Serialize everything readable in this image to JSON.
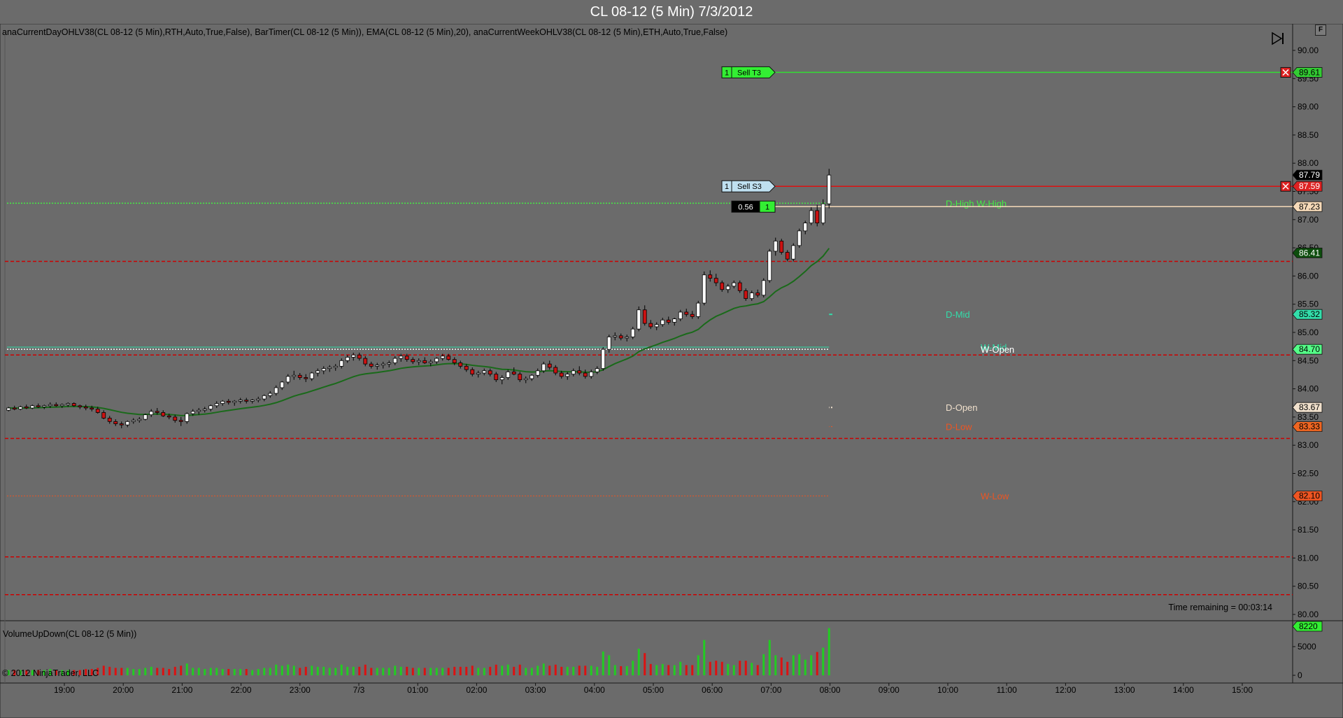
{
  "window": {
    "title": "CL 08-12 (5 Min)  7/3/2012"
  },
  "indicators_text": "anaCurrentDayOHLV38(CL  08-12  (5  Min),RTH,Auto,True,False),  BarTimer(CL  08-12  (5  Min)),  EMA(CL  08-12  (5  Min),20),  anaCurrentWeekOHLV38(CL  08-12  (5  Min),ETH,Auto,True,False)",
  "volume_panel_label": "VolumeUpDown(CL 08-12 (5 Min))",
  "copyright": "© 2012 NinjaTrader, LLC",
  "time_remaining": "Time remaining = 00:03:14",
  "f_button_label": "F",
  "colors": {
    "background": "#6b6b6b",
    "up_candle": "#ffffff",
    "down_candle": "#cc1111",
    "ema": "#1a6a1a",
    "green_level": "#33cc33",
    "red_level": "#cc0000",
    "volume_up": "#22cc22",
    "volume_down": "#dd1111"
  },
  "price_axis": {
    "min": 80.0,
    "max": 90.0,
    "ticks": [
      "80.00",
      "80.50",
      "81.00",
      "81.50",
      "82.00",
      "82.50",
      "83.00",
      "83.50",
      "84.00",
      "84.50",
      "85.00",
      "85.50",
      "86.00",
      "86.50",
      "87.00",
      "87.50",
      "88.00",
      "88.50",
      "89.00",
      "89.50",
      "90.00"
    ]
  },
  "volume_axis": {
    "ticks": [
      "0",
      "5000"
    ],
    "max": 9000,
    "last_volume": "8220"
  },
  "time_axis": {
    "labels": [
      "19:00",
      "20:00",
      "21:00",
      "22:00",
      "23:00",
      "7/3",
      "01:00",
      "02:00",
      "03:00",
      "04:00",
      "05:00",
      "06:00",
      "07:00",
      "08:00",
      "09:00",
      "10:00",
      "11:00",
      "12:00",
      "13:00",
      "14:00",
      "15:00"
    ]
  },
  "price_badges": [
    {
      "text": "89.61",
      "value": 89.61,
      "bg": "#33cc33",
      "fg": "#000000"
    },
    {
      "text": "87.79",
      "value": 87.79,
      "bg": "#000000",
      "fg": "#ffffff"
    },
    {
      "text": "87.59",
      "value": 87.59,
      "bg": "#dd2222",
      "fg": "#ffffff"
    },
    {
      "text": "87.23",
      "value": 87.23,
      "bg": "#f5d9b8",
      "fg": "#000000"
    },
    {
      "text": "86.41",
      "value": 86.41,
      "bg": "#0d4d0d",
      "fg": "#ffffff"
    },
    {
      "text": "85.32",
      "value": 85.32,
      "bg": "#33ddaa",
      "fg": "#000000"
    },
    {
      "text": "84.70",
      "value": 84.7,
      "bg": "#55ff88",
      "fg": "#000000"
    },
    {
      "text": "83.67",
      "value": 83.67,
      "bg": "#f0e0cc",
      "fg": "#000000"
    },
    {
      "text": "83.33",
      "value": 83.33,
      "bg": "#ee6622",
      "fg": "#000000"
    },
    {
      "text": "82.10",
      "value": 82.1,
      "bg": "#ee5522",
      "fg": "#000000"
    }
  ],
  "orders": [
    {
      "qty": "1",
      "label": "Sell T3",
      "price": 89.61,
      "type": "target"
    },
    {
      "qty": "1",
      "label": "Sell S3",
      "price": 87.59,
      "type": "stop"
    },
    {
      "qty": "1",
      "pnl": "0.56",
      "price": 87.23,
      "type": "position"
    }
  ],
  "level_labels": [
    {
      "text": "D-High  W-High",
      "value": 87.29,
      "color": "#44ee44"
    },
    {
      "text": "D-Mid",
      "value": 85.32,
      "color": "#33ddaa"
    },
    {
      "text": "W-Mid",
      "value": 84.74,
      "color": "#33ddaa"
    },
    {
      "text": "W-Open",
      "value": 84.7,
      "color": "#ffffff"
    },
    {
      "text": "D-Open",
      "value": 83.67,
      "color": "#f0e0cc"
    },
    {
      "text": "D-Low",
      "value": 83.33,
      "color": "#ee5522"
    },
    {
      "text": "W-Low",
      "value": 82.1,
      "color": "#ee5522"
    }
  ],
  "red_dashed_levels": [
    86.26,
    84.6,
    83.12,
    81.02,
    80.35
  ],
  "chart_data": {
    "type": "candlestick",
    "bar_interval_min": 5,
    "time_start": "18:05",
    "candles": [
      [
        83.62,
        83.68,
        83.6,
        83.66
      ],
      [
        83.66,
        83.7,
        83.62,
        83.64
      ],
      [
        83.64,
        83.7,
        83.62,
        83.68
      ],
      [
        83.68,
        83.72,
        83.64,
        83.66
      ],
      [
        83.66,
        83.72,
        83.64,
        83.7
      ],
      [
        83.7,
        83.74,
        83.66,
        83.68
      ],
      [
        83.68,
        83.72,
        83.64,
        83.7
      ],
      [
        83.7,
        83.76,
        83.66,
        83.72
      ],
      [
        83.72,
        83.76,
        83.68,
        83.7
      ],
      [
        83.7,
        83.74,
        83.66,
        83.72
      ],
      [
        83.72,
        83.76,
        83.68,
        83.74
      ],
      [
        83.74,
        83.76,
        83.68,
        83.7
      ],
      [
        83.7,
        83.72,
        83.64,
        83.68
      ],
      [
        83.68,
        83.72,
        83.62,
        83.66
      ],
      [
        83.66,
        83.7,
        83.6,
        83.64
      ],
      [
        83.64,
        83.68,
        83.56,
        83.58
      ],
      [
        83.58,
        83.62,
        83.46,
        83.48
      ],
      [
        83.48,
        83.52,
        83.38,
        83.42
      ],
      [
        83.42,
        83.46,
        83.34,
        83.38
      ],
      [
        83.38,
        83.42,
        83.3,
        83.36
      ],
      [
        83.36,
        83.44,
        83.32,
        83.42
      ],
      [
        83.42,
        83.48,
        83.38,
        83.44
      ],
      [
        83.44,
        83.5,
        83.4,
        83.46
      ],
      [
        83.46,
        83.56,
        83.44,
        83.54
      ],
      [
        83.54,
        83.64,
        83.5,
        83.6
      ],
      [
        83.6,
        83.66,
        83.54,
        83.58
      ],
      [
        83.58,
        83.62,
        83.5,
        83.52
      ],
      [
        83.52,
        83.56,
        83.46,
        83.5
      ],
      [
        83.5,
        83.54,
        83.4,
        83.44
      ],
      [
        83.44,
        83.5,
        83.34,
        83.42
      ],
      [
        83.42,
        83.58,
        83.38,
        83.56
      ],
      [
        83.56,
        83.64,
        83.52,
        83.6
      ],
      [
        83.6,
        83.66,
        83.54,
        83.62
      ],
      [
        83.62,
        83.68,
        83.58,
        83.64
      ],
      [
        83.64,
        83.72,
        83.6,
        83.7
      ],
      [
        83.7,
        83.78,
        83.66,
        83.74
      ],
      [
        83.74,
        83.8,
        83.7,
        83.78
      ],
      [
        83.78,
        83.82,
        83.72,
        83.76
      ],
      [
        83.76,
        83.8,
        83.7,
        83.78
      ],
      [
        83.78,
        83.84,
        83.74,
        83.8
      ],
      [
        83.8,
        83.84,
        83.74,
        83.78
      ],
      [
        83.78,
        83.82,
        83.74,
        83.8
      ],
      [
        83.8,
        83.86,
        83.76,
        83.82
      ],
      [
        83.82,
        83.9,
        83.78,
        83.88
      ],
      [
        83.88,
        83.96,
        83.84,
        83.92
      ],
      [
        83.92,
        84.06,
        83.88,
        84.02
      ],
      [
        84.02,
        84.14,
        83.98,
        84.12
      ],
      [
        84.12,
        84.26,
        84.08,
        84.22
      ],
      [
        84.22,
        84.32,
        84.16,
        84.24
      ],
      [
        84.24,
        84.28,
        84.16,
        84.2
      ],
      [
        84.2,
        84.26,
        84.12,
        84.18
      ],
      [
        84.18,
        84.3,
        84.14,
        84.28
      ],
      [
        84.28,
        84.36,
        84.22,
        84.32
      ],
      [
        84.32,
        84.4,
        84.26,
        84.36
      ],
      [
        84.36,
        84.42,
        84.3,
        84.38
      ],
      [
        84.38,
        84.44,
        84.32,
        84.4
      ],
      [
        84.4,
        84.54,
        84.36,
        84.5
      ],
      [
        84.5,
        84.6,
        84.46,
        84.56
      ],
      [
        84.56,
        84.64,
        84.5,
        84.6
      ],
      [
        84.6,
        84.64,
        84.5,
        84.54
      ],
      [
        84.54,
        84.58,
        84.4,
        84.44
      ],
      [
        84.44,
        84.48,
        84.36,
        84.4
      ],
      [
        84.4,
        84.46,
        84.34,
        84.42
      ],
      [
        84.42,
        84.48,
        84.36,
        84.44
      ],
      [
        84.44,
        84.5,
        84.38,
        84.46
      ],
      [
        84.46,
        84.58,
        84.42,
        84.54
      ],
      [
        84.54,
        84.62,
        84.48,
        84.58
      ],
      [
        84.58,
        84.62,
        84.48,
        84.52
      ],
      [
        84.52,
        84.56,
        84.44,
        84.48
      ],
      [
        84.48,
        84.54,
        84.42,
        84.5
      ],
      [
        84.5,
        84.56,
        84.44,
        84.46
      ],
      [
        84.46,
        84.52,
        84.4,
        84.48
      ],
      [
        84.48,
        84.56,
        84.44,
        84.54
      ],
      [
        84.54,
        84.62,
        84.5,
        84.58
      ],
      [
        84.58,
        84.62,
        84.5,
        84.52
      ],
      [
        84.52,
        84.56,
        84.42,
        84.46
      ],
      [
        84.46,
        84.5,
        84.36,
        84.4
      ],
      [
        84.4,
        84.44,
        84.3,
        84.34
      ],
      [
        84.34,
        84.38,
        84.22,
        84.26
      ],
      [
        84.26,
        84.32,
        84.2,
        84.28
      ],
      [
        84.28,
        84.36,
        84.24,
        84.32
      ],
      [
        84.32,
        84.36,
        84.22,
        84.26
      ],
      [
        84.26,
        84.3,
        84.12,
        84.16
      ],
      [
        84.16,
        84.24,
        84.08,
        84.2
      ],
      [
        84.2,
        84.34,
        84.16,
        84.3
      ],
      [
        84.3,
        84.38,
        84.24,
        84.26
      ],
      [
        84.26,
        84.3,
        84.12,
        84.16
      ],
      [
        84.16,
        84.22,
        84.1,
        84.18
      ],
      [
        84.18,
        84.26,
        84.14,
        84.24
      ],
      [
        84.24,
        84.36,
        84.2,
        84.32
      ],
      [
        84.32,
        84.48,
        84.28,
        84.44
      ],
      [
        84.44,
        84.5,
        84.34,
        84.38
      ],
      [
        84.38,
        84.42,
        84.24,
        84.28
      ],
      [
        84.28,
        84.32,
        84.18,
        84.22
      ],
      [
        84.22,
        84.3,
        84.16,
        84.26
      ],
      [
        84.26,
        84.36,
        84.22,
        84.32
      ],
      [
        84.32,
        84.4,
        84.24,
        84.28
      ],
      [
        84.28,
        84.34,
        84.18,
        84.22
      ],
      [
        84.22,
        84.34,
        84.18,
        84.3
      ],
      [
        84.3,
        84.4,
        84.26,
        84.36
      ],
      [
        84.36,
        84.74,
        84.32,
        84.7
      ],
      [
        84.7,
        84.96,
        84.64,
        84.92
      ],
      [
        84.92,
        85.0,
        84.86,
        84.94
      ],
      [
        84.94,
        84.98,
        84.86,
        84.9
      ],
      [
        84.9,
        84.96,
        84.84,
        84.92
      ],
      [
        84.92,
        85.1,
        84.88,
        85.06
      ],
      [
        85.06,
        85.46,
        85.02,
        85.4
      ],
      [
        85.4,
        85.48,
        85.12,
        85.16
      ],
      [
        85.16,
        85.22,
        85.06,
        85.1
      ],
      [
        85.1,
        85.18,
        85.04,
        85.14
      ],
      [
        85.14,
        85.26,
        85.1,
        85.22
      ],
      [
        85.22,
        85.28,
        85.14,
        85.18
      ],
      [
        85.18,
        85.26,
        85.12,
        85.24
      ],
      [
        85.24,
        85.4,
        85.2,
        85.36
      ],
      [
        85.36,
        85.42,
        85.28,
        85.32
      ],
      [
        85.32,
        85.38,
        85.24,
        85.28
      ],
      [
        85.28,
        85.56,
        85.24,
        85.52
      ],
      [
        85.52,
        86.08,
        85.48,
        86.02
      ],
      [
        86.02,
        86.1,
        85.9,
        85.96
      ],
      [
        85.96,
        86.04,
        85.82,
        85.88
      ],
      [
        85.88,
        85.92,
        85.72,
        85.76
      ],
      [
        85.76,
        85.86,
        85.7,
        85.82
      ],
      [
        85.82,
        85.92,
        85.78,
        85.88
      ],
      [
        85.88,
        85.92,
        85.7,
        85.74
      ],
      [
        85.74,
        85.78,
        85.56,
        85.6
      ],
      [
        85.6,
        85.74,
        85.56,
        85.7
      ],
      [
        85.7,
        85.76,
        85.62,
        85.66
      ],
      [
        85.66,
        85.96,
        85.62,
        85.92
      ],
      [
        85.92,
        86.48,
        85.88,
        86.44
      ],
      [
        86.44,
        86.68,
        86.36,
        86.62
      ],
      [
        86.62,
        86.66,
        86.38,
        86.42
      ],
      [
        86.42,
        86.46,
        86.26,
        86.3
      ],
      [
        86.3,
        86.58,
        86.26,
        86.54
      ],
      [
        86.54,
        86.84,
        86.5,
        86.8
      ],
      [
        86.8,
        86.98,
        86.74,
        86.94
      ],
      [
        86.94,
        87.22,
        86.9,
        87.16
      ],
      [
        87.16,
        87.26,
        86.88,
        86.94
      ],
      [
        86.94,
        87.36,
        86.9,
        87.28
      ],
      [
        87.28,
        87.9,
        87.2,
        87.79
      ]
    ],
    "ema_period": 20,
    "volume_colors": "up=green,down=red"
  }
}
